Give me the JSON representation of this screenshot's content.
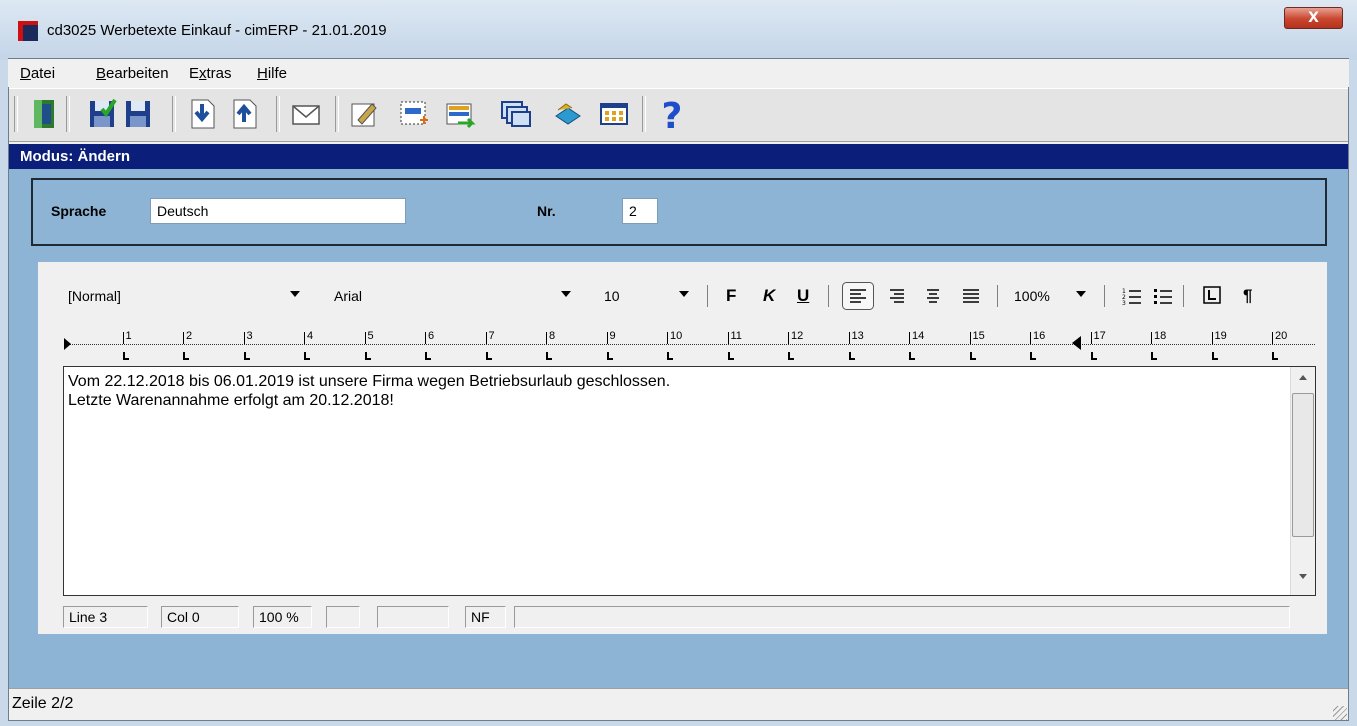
{
  "window": {
    "title": "cd3025 Werbetexte Einkauf - cimERP - 21.01.2019",
    "close_label": "X"
  },
  "menu": {
    "items": [
      "Datei",
      "Bearbeiten",
      "Extras",
      "Hilfe"
    ]
  },
  "toolbar": {
    "icons": [
      "exit-icon",
      "save-new-icon",
      "save-icon",
      "import-icon",
      "export-icon",
      "mail-icon",
      "edit-icon",
      "new-record-icon",
      "transfer-icon",
      "windows-icon",
      "book-icon",
      "grid-icon",
      "help-icon"
    ]
  },
  "mode": "Modus: Ändern",
  "header": {
    "language_label": "Sprache",
    "language_value": "Deutsch",
    "number_label": "Nr.",
    "number_value": "2"
  },
  "format_bar": {
    "style": "[Normal]",
    "font": "Arial",
    "size": "10",
    "bold": "F",
    "italic": "K",
    "underline": "U",
    "zoom": "100%",
    "pilcrow": "¶"
  },
  "ruler": {
    "numbers": [
      "1",
      "2",
      "3",
      "4",
      "5",
      "6",
      "7",
      "8",
      "9",
      "10",
      "11",
      "12",
      "13",
      "14",
      "15",
      "16",
      "17",
      "18",
      "19",
      "20"
    ]
  },
  "editor": {
    "lines": [
      "Vom 22.12.2018 bis 06.01.2019 ist unsere Firma wegen Betriebsurlaub geschlossen.",
      "Letzte Warenannahme erfolgt am 20.12.2018!"
    ]
  },
  "editor_status": {
    "line": "Line  3",
    "col": "Col  0",
    "zoom": "100 %",
    "mode": "NF"
  },
  "status_bar": {
    "text": "Zeile 2/2"
  },
  "colors": {
    "mode_bar": "#0a1e7a",
    "panel_bg": "#8db4d4",
    "close_button": "#c9462f"
  }
}
